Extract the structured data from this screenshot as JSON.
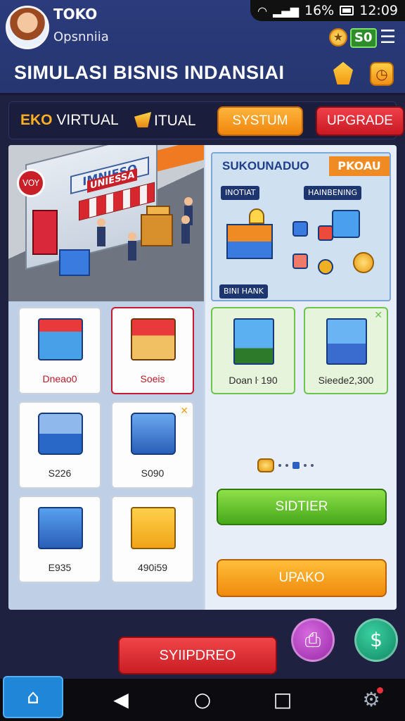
{
  "status_bar": {
    "battery": "16%",
    "time": "12:09"
  },
  "header": {
    "store_name": "TOKO",
    "store_subtitle": "Opsnniia",
    "balance": "S0",
    "game_title": "SIMULASI BISNIS INDANSIAI"
  },
  "tabs": {
    "virtual_prefix": "EKO",
    "virtual_label": "VIRTUAL",
    "itual_label": "ITUAL",
    "systum_label": "SYSTUM",
    "upgrade_label": "UPGRADE"
  },
  "scene": {
    "sign_text": "IMNIESO",
    "awning_text": "UNIESSA",
    "logo_text": "VOY"
  },
  "left_cards": [
    {
      "label": "Dneao0"
    },
    {
      "label": "Soeis"
    },
    {
      "label": "S226"
    },
    {
      "label": "S090"
    },
    {
      "label": "E935"
    },
    {
      "label": "490i59"
    }
  ],
  "info_panel": {
    "title": "SUKOUNADUO",
    "tag": "PKOAU",
    "chip_1": "INOTIAT",
    "chip_2": "HAINBENING",
    "chip_3": "BINI HANK"
  },
  "right_cards": [
    {
      "label": "Doan ŀ 190"
    },
    {
      "label": "Sieede2,300"
    }
  ],
  "actions": {
    "green_button": "SIDTIER",
    "orange_button": "UPAKO",
    "red_button": "SYIIPDREO"
  },
  "icons": {
    "battery_icon": "battery-icon",
    "wifi_icon": "wifi-icon",
    "home_icon": "home-icon",
    "gear_icon": "gear-icon"
  },
  "colors": {
    "background": "#1e2140",
    "header": "#2b3b7c",
    "accent_orange": "#f0860c",
    "accent_red": "#c81a22",
    "accent_green": "#46a81a"
  }
}
